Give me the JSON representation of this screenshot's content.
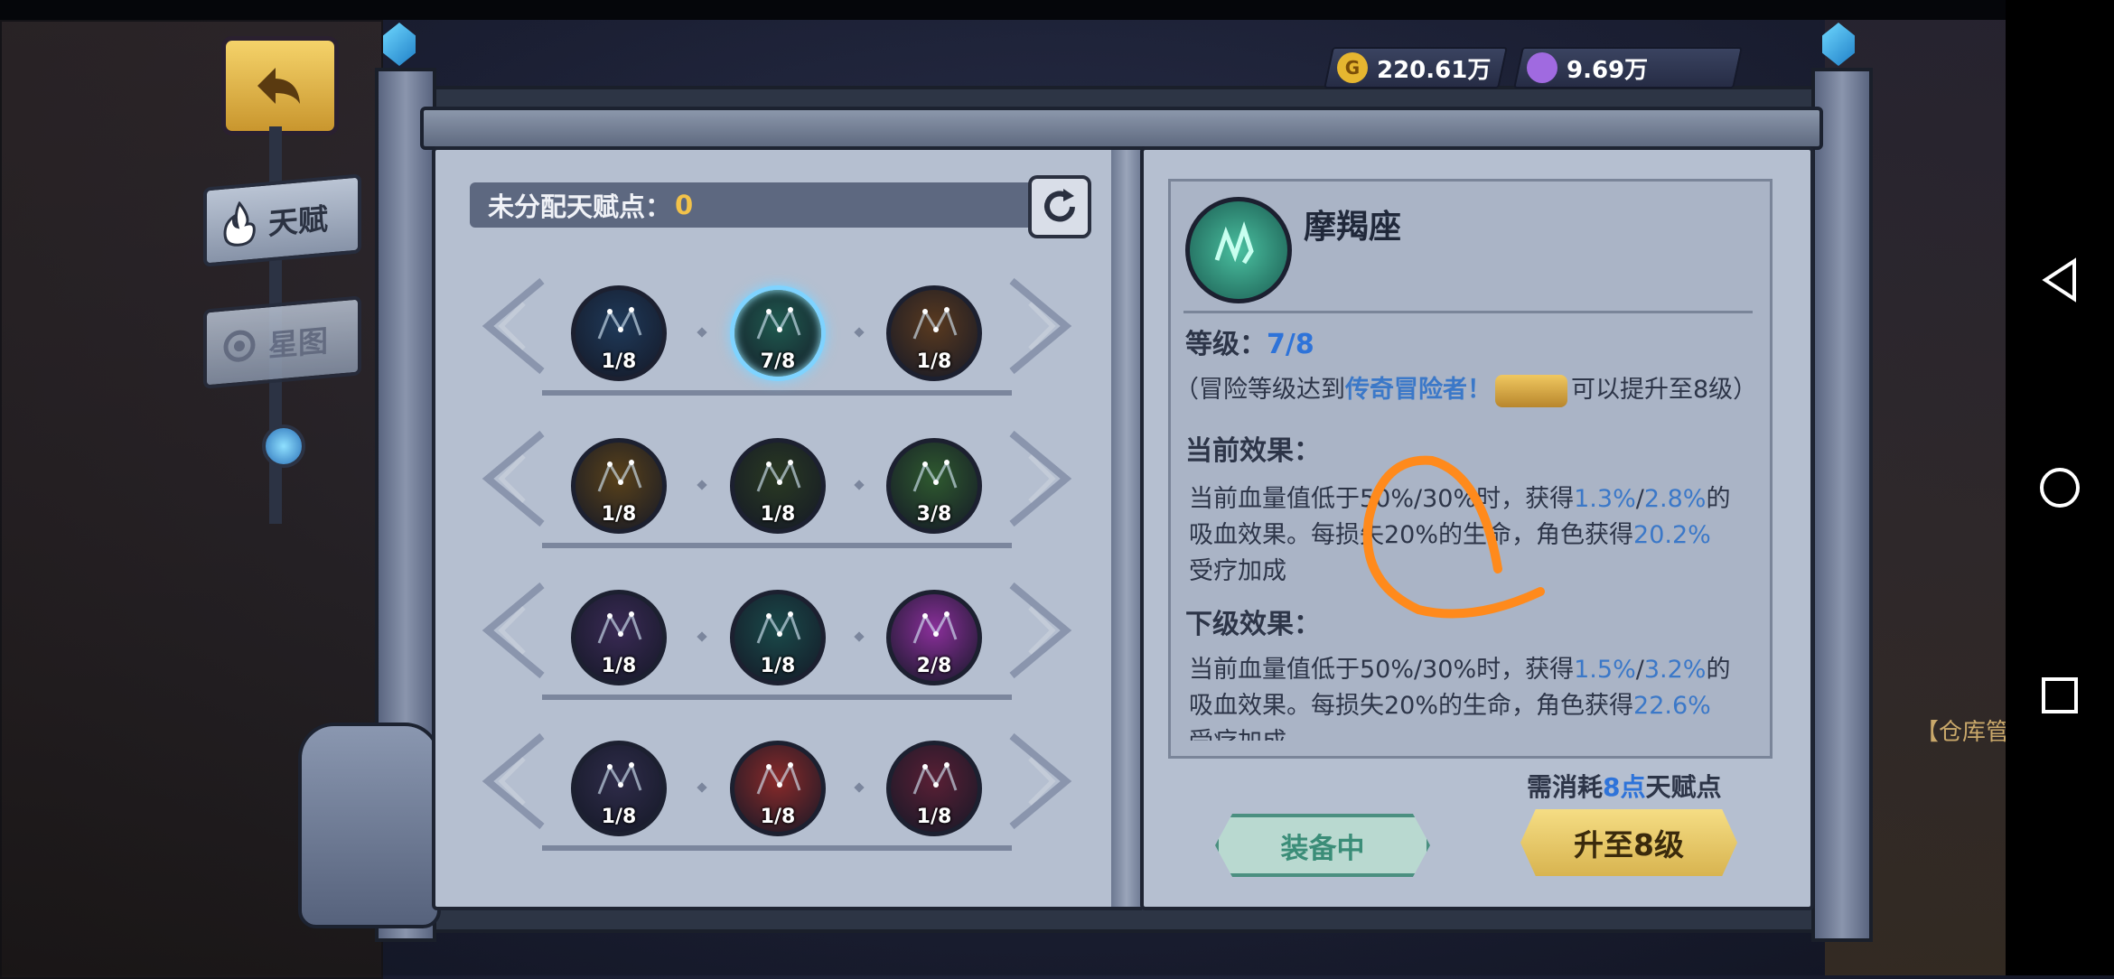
{
  "currency": {
    "gold": {
      "icon": "gold-coin-icon",
      "symbol": "G",
      "value": "220.61万"
    },
    "gem": {
      "icon": "purple-gem-icon",
      "value": "9.69万"
    }
  },
  "sidebar": {
    "back": {
      "icon": "back-arrow-icon"
    },
    "tabs": [
      {
        "label": "天赋",
        "icon": "flame-icon"
      },
      {
        "label": "星图",
        "icon": "star-map-icon"
      }
    ]
  },
  "left_panel": {
    "points_label": "未分配天赋点：",
    "points_value": "0",
    "constellations": [
      {
        "level": "1/8",
        "color": "#1f3a5a"
      },
      {
        "level": "7/8",
        "color": "#1f5a4f"
      },
      {
        "level": "1/8",
        "color": "#5a3a1f"
      },
      {
        "level": "1/8",
        "color": "#5a421a"
      },
      {
        "level": "1/8",
        "color": "#2a3a22"
      },
      {
        "level": "3/8",
        "color": "#2f5a2f"
      },
      {
        "level": "1/8",
        "color": "#3a2a55"
      },
      {
        "level": "1/8",
        "color": "#1a4a4a"
      },
      {
        "level": "2/8",
        "color": "#8a2f9a"
      },
      {
        "level": "1/8",
        "color": "#2f2c4a"
      },
      {
        "level": "1/8",
        "color": "#8a2a2a"
      },
      {
        "level": "1/8",
        "color": "#5a1f35"
      }
    ]
  },
  "detail": {
    "title": "摩羯座",
    "level_label": "等级：",
    "level_value": "7/8",
    "note_pre": "（冒险等级达到",
    "note_highlight": "传奇冒险者！",
    "note_post": "可以提升至8级）",
    "current_heading": "当前效果：",
    "current_1a": "当前血量值低于50%/30%时，获得",
    "current_1b": "1.3%",
    "current_1c": "/",
    "current_1d": "2.8%",
    "current_1e": "的",
    "current_2a": "吸血效果。每损失20%的生命，角色获得",
    "current_2b": "20.2%",
    "current_3": "受疗加成",
    "next_heading": "下级效果：",
    "next_1a": "当前血量值低于50%/30%时，获得",
    "next_1b": "1.5%",
    "next_1c": "/",
    "next_1d": "3.2%",
    "next_1e": "的",
    "next_2a": "吸血效果。每损失20%的生命，角色获得",
    "next_2b": "22.6%",
    "next_3": "受疗加成",
    "cost_pre": "需消耗",
    "cost_value": "8点",
    "cost_post": "天赋点",
    "equip_label": "装备中",
    "upgrade_label": "升至8级"
  },
  "right_edge": {
    "label": "【仓库管理员】"
  },
  "colors": {
    "accent_gold": "#f2c24a",
    "highlight_blue": "#2e73d9",
    "annotation_orange": "#ff8a1c"
  }
}
